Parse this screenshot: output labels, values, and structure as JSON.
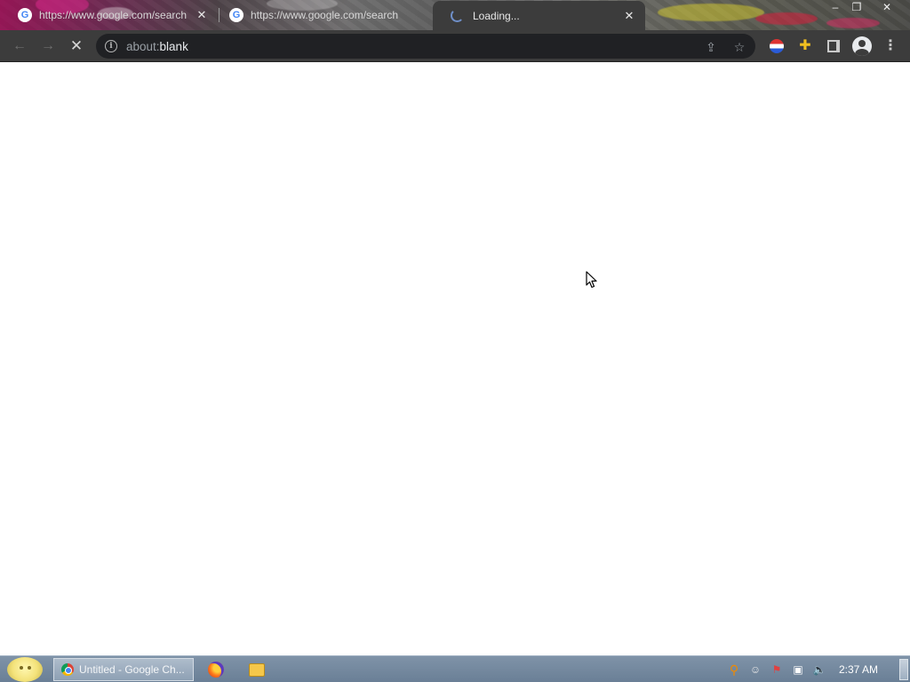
{
  "browser": {
    "tabs": [
      {
        "title": "https://www.google.com/search",
        "favicon": "google-g-icon",
        "active": false
      },
      {
        "title": "https://www.google.com/search",
        "favicon": "google-g-icon",
        "active": false
      },
      {
        "title": "Loading...",
        "favicon": "loading-spinner-icon",
        "active": true
      }
    ],
    "window_controls": [
      "minimize-icon",
      "restore-icon",
      "close-icon"
    ],
    "toolbar": {
      "url_scheme": "about:",
      "url_host": "blank",
      "icons": [
        "back-arrow-icon",
        "forward-arrow-icon",
        "stop-loading-icon",
        "site-info-icon",
        "share-icon",
        "bookmark-star-icon",
        "extension-flag-icon",
        "extensions-puzzle-icon",
        "side-panel-icon",
        "profile-avatar-icon",
        "menu-kebab-icon"
      ]
    },
    "page": {
      "content": ""
    }
  },
  "taskbar": {
    "start_icon": "start-smiley-icon",
    "active_window": {
      "label": "Untitled - Google Ch...",
      "icon": "chrome-icon"
    },
    "quick_launch": [
      "firefox-icon",
      "folder-icon"
    ],
    "tray_icons": [
      "search-magnifier-icon",
      "smiley-status-icon",
      "flag-alert-icon",
      "network-icon",
      "volume-icon"
    ],
    "clock": "2:37 AM"
  },
  "colors": {
    "toolbar_bg": "#3c3c3c",
    "omnibox_bg": "#202124",
    "taskbar_bg": "#7f93a8",
    "page_bg": "#ffffff"
  }
}
